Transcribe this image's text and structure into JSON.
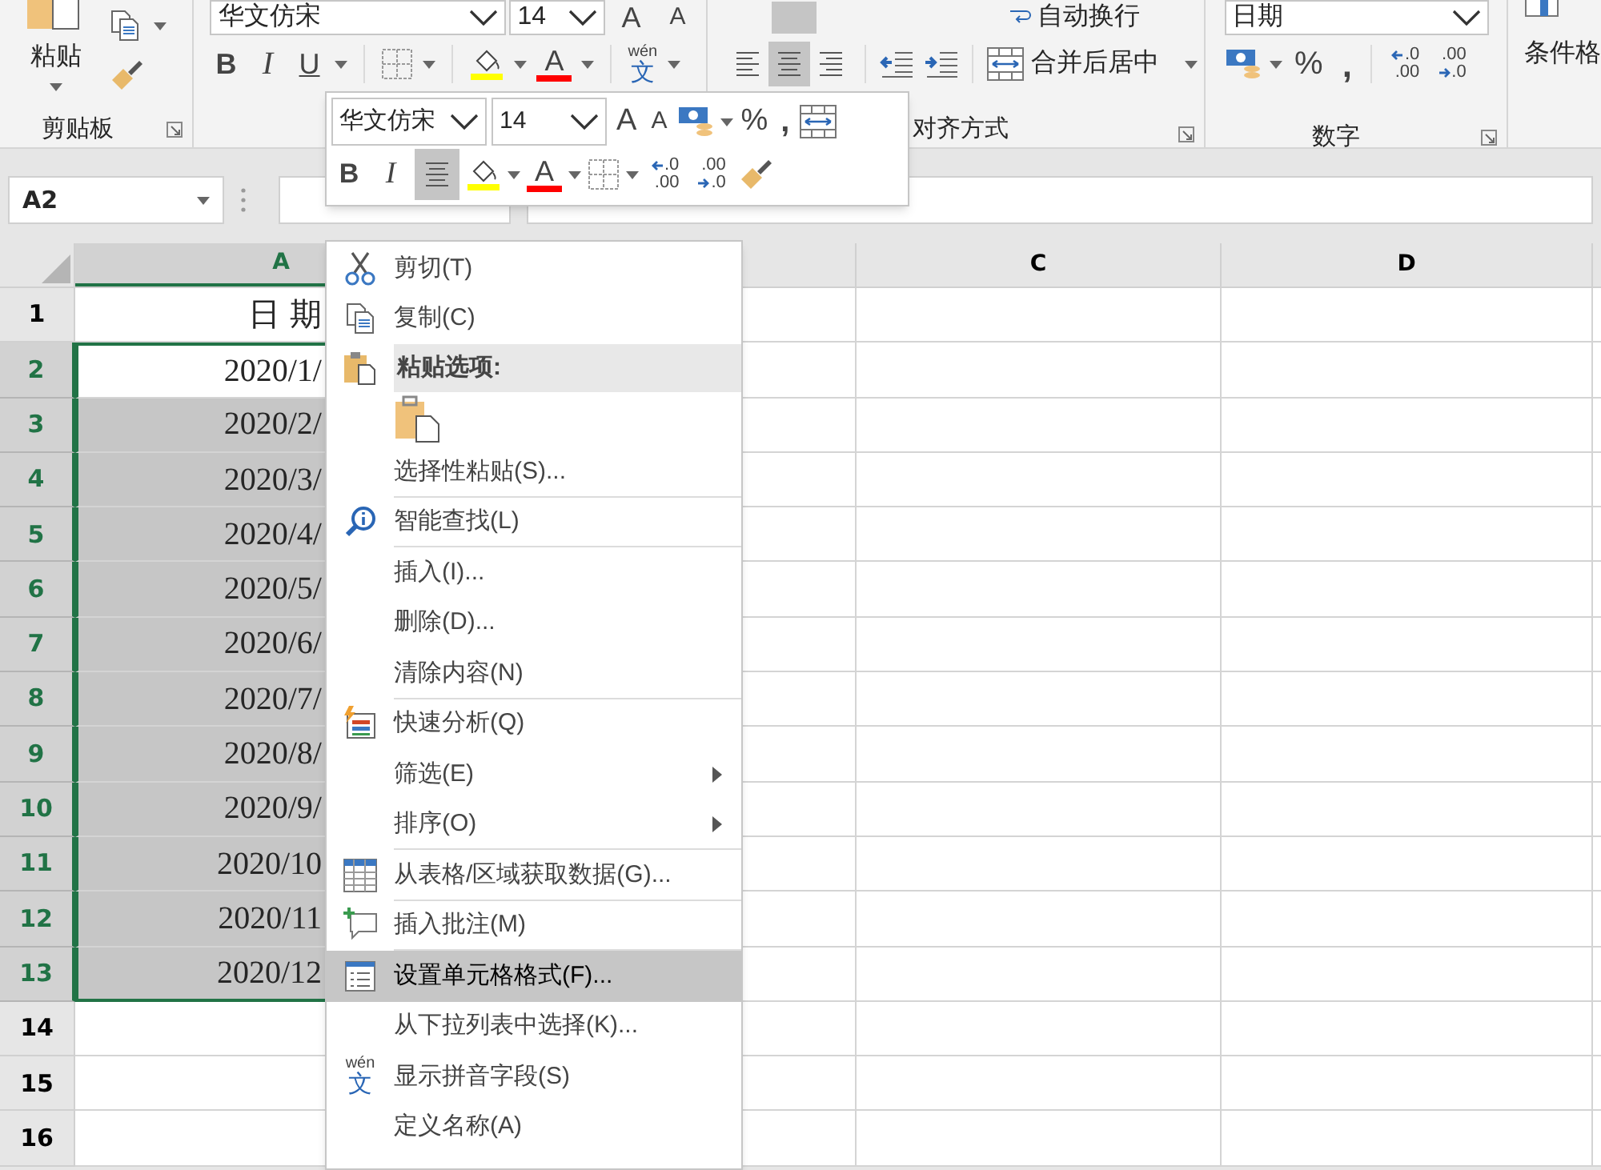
{
  "ribbon": {
    "clipboard": {
      "paste": "粘贴",
      "group_label": "剪贴板"
    },
    "font": {
      "font_name": "华文仿宋",
      "font_size": "14",
      "grow": "A",
      "shrink": "A",
      "bold": "B",
      "italic": "I",
      "underline": "U",
      "font_color": "A",
      "phonetic_top": "wén",
      "phonetic_bottom": "文"
    },
    "alignment": {
      "wrap_text": "自动换行",
      "merge": "合并后居中",
      "group_label": "对齐方式",
      "align_buttons": [
        {
          "selected": false
        },
        {
          "selected": true
        },
        {
          "selected": false
        }
      ]
    },
    "number": {
      "format": "日期",
      "percent": "%",
      "comma": ",",
      "inc_top": ".0",
      "inc_bottom": ".00",
      "dec_top": ".00",
      "dec_bottom": ".0",
      "group_label": "数字"
    },
    "styles": {
      "conditional": "条件格"
    }
  },
  "name_box": "A2",
  "mini_toolbar": {
    "font_name": "华文仿宋",
    "font_size": "14",
    "grow": "A",
    "shrink": "A",
    "percent": "%",
    "comma": ",",
    "bold": "B",
    "italic": "I",
    "center_selected": true,
    "font_color": "A",
    "inc_top": ".0",
    "inc_bottom": ".00",
    "dec_top": ".00",
    "dec_bottom": ".0"
  },
  "columns": [
    {
      "label": "A",
      "selected": true
    },
    {
      "selected": false
    },
    {
      "label": "C",
      "selected": false
    },
    {
      "label": "D",
      "selected": false
    }
  ],
  "rows": [
    {
      "header": "1",
      "selected": false,
      "active": false,
      "cell": "日期"
    },
    {
      "header": "2",
      "selected": true,
      "active": true,
      "cell": "2020/1/"
    },
    {
      "header": "3",
      "selected": true,
      "active": false,
      "cell": "2020/2/"
    },
    {
      "header": "4",
      "selected": true,
      "active": false,
      "cell": "2020/3/"
    },
    {
      "header": "5",
      "selected": true,
      "active": false,
      "cell": "2020/4/"
    },
    {
      "header": "6",
      "selected": true,
      "active": false,
      "cell": "2020/5/"
    },
    {
      "header": "7",
      "selected": true,
      "active": false,
      "cell": "2020/6/"
    },
    {
      "header": "8",
      "selected": true,
      "active": false,
      "cell": "2020/7/"
    },
    {
      "header": "9",
      "selected": true,
      "active": false,
      "cell": "2020/8/"
    },
    {
      "header": "10",
      "selected": true,
      "active": false,
      "cell": "2020/9/"
    },
    {
      "header": "11",
      "selected": true,
      "active": false,
      "cell": "2020/10"
    },
    {
      "header": "12",
      "selected": true,
      "active": false,
      "cell": "2020/11"
    },
    {
      "header": "13",
      "selected": true,
      "active": false,
      "cell": "2020/12"
    },
    {
      "header": "14",
      "selected": false,
      "active": false
    },
    {
      "header": "15",
      "selected": false,
      "active": false
    },
    {
      "header": "16",
      "selected": false,
      "active": false
    }
  ],
  "context_menu": {
    "items": [
      {
        "kind": "item",
        "label": "剪切(T)",
        "selected": false,
        "submenu": false,
        "separator": false
      },
      {
        "kind": "item",
        "label": "复制(C)",
        "selected": false,
        "submenu": false,
        "separator": false
      },
      {
        "kind": "header",
        "label": "粘贴选项:",
        "selected": false
      },
      {
        "kind": "paste_option",
        "selected": false
      },
      {
        "kind": "item",
        "label": "选择性粘贴(S)...",
        "selected": false,
        "submenu": false,
        "separator": true
      },
      {
        "kind": "item",
        "label": "智能查找(L)",
        "selected": false,
        "submenu": false,
        "separator": true
      },
      {
        "kind": "item",
        "label": "插入(I)...",
        "selected": false,
        "submenu": false,
        "separator": false
      },
      {
        "kind": "item",
        "label": "删除(D)...",
        "selected": false,
        "submenu": false,
        "separator": false
      },
      {
        "kind": "item",
        "label": "清除内容(N)",
        "selected": false,
        "submenu": false,
        "separator": true
      },
      {
        "kind": "item",
        "label": "快速分析(Q)",
        "selected": false,
        "submenu": false,
        "separator": false
      },
      {
        "kind": "item",
        "label": "筛选(E)",
        "selected": false,
        "submenu": true,
        "separator": false
      },
      {
        "kind": "item",
        "label": "排序(O)",
        "selected": false,
        "submenu": true,
        "separator": true
      },
      {
        "kind": "item",
        "label": "从表格/区域获取数据(G)...",
        "selected": false,
        "submenu": false,
        "separator": true
      },
      {
        "kind": "item",
        "label": "插入批注(M)",
        "selected": false,
        "submenu": false,
        "separator": true
      },
      {
        "kind": "item",
        "label": "设置单元格格式(F)...",
        "selected": true,
        "submenu": false,
        "separator": false
      },
      {
        "kind": "item",
        "label": "从下拉列表中选择(K)...",
        "selected": false,
        "submenu": false,
        "separator": false
      },
      {
        "kind": "phonetic",
        "label": "显示拼音字段(S)",
        "icon_top": "wén",
        "icon_bottom": "文",
        "selected": false,
        "submenu": false,
        "separator": false
      },
      {
        "kind": "item",
        "label": "定义名称(A)",
        "selected": false,
        "submenu": false,
        "separator": false
      }
    ]
  }
}
